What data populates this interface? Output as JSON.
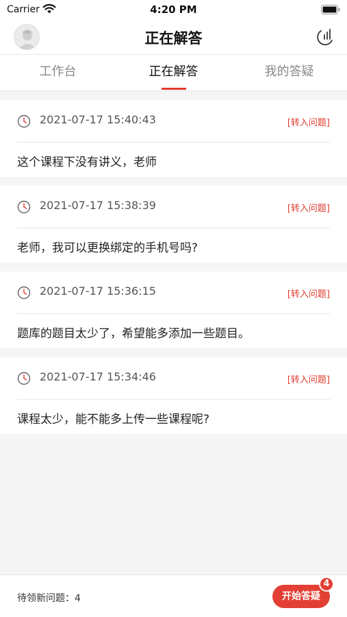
{
  "status_bar": {
    "carrier": "Carrier",
    "time": "4:20 PM"
  },
  "nav": {
    "title": "正在解答",
    "avatar_icon": "avatar-placeholder-icon",
    "stats_icon": "statistics-icon"
  },
  "tabs": [
    {
      "label": "工作台",
      "active": false
    },
    {
      "label": "正在解答",
      "active": true
    },
    {
      "label": "我的答疑",
      "active": false
    }
  ],
  "questions": [
    {
      "time": "2021-07-17 15:40:43",
      "action": "[转入问题]",
      "text": "这个课程下没有讲义，老师"
    },
    {
      "time": "2021-07-17 15:38:39",
      "action": "[转入问题]",
      "text": "老师，我可以更换绑定的手机号吗?"
    },
    {
      "time": "2021-07-17 15:36:15",
      "action": "[转入问题]",
      "text": "题库的题目太少了，希望能多添加一些题目。"
    },
    {
      "time": "2021-07-17 15:34:46",
      "action": "[转入问题]",
      "text": "课程太少，能不能多上传一些课程呢?"
    }
  ],
  "footer": {
    "pending_label": "待领新问题：4",
    "start_button": "开始答疑",
    "badge": "4"
  },
  "colors": {
    "accent": "#e03c2e",
    "background": "#f5f5f5"
  }
}
